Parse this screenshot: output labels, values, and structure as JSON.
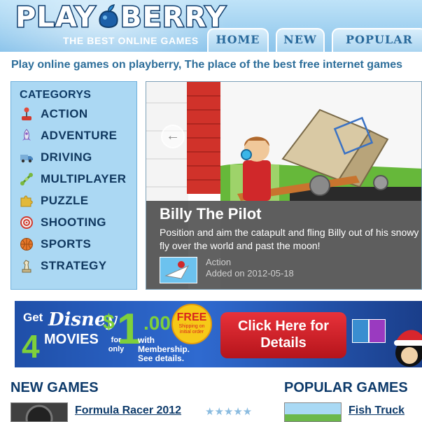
{
  "header": {
    "logo_left": "PLAY",
    "logo_right": "BERRY",
    "tagline": "THE BEST ONLINE GAMES",
    "tabs": [
      {
        "label": "HOME"
      },
      {
        "label": "NEW"
      },
      {
        "label": "POPULAR"
      }
    ]
  },
  "intro": "Play online games on playberry, The place of the best free internet games",
  "categories": {
    "title": "CATEGORYS",
    "items": [
      {
        "label": "ACTION",
        "icon": "joystick-icon"
      },
      {
        "label": "ADVENTURE",
        "icon": "rocket-icon"
      },
      {
        "label": "DRIVING",
        "icon": "truck-icon"
      },
      {
        "label": "MULTIPLAYER",
        "icon": "network-icon"
      },
      {
        "label": "PUZZLE",
        "icon": "puzzle-piece-icon"
      },
      {
        "label": "SHOOTING",
        "icon": "crosshair-icon"
      },
      {
        "label": "SPORTS",
        "icon": "basketball-icon"
      },
      {
        "label": "STRATEGY",
        "icon": "chess-icon"
      }
    ]
  },
  "featured": {
    "title": "Billy The Pilot",
    "description": "Position and aim the catapult and fling Billy out of his snowy you can fly over the world and past the moon!",
    "category": "Action",
    "added": "Added on 2012-05-18"
  },
  "banner": {
    "get": "Get",
    "brand": "Disney",
    "count": "4",
    "movies": "MOVIES",
    "dollar": "$",
    "price_whole": "1",
    "price_cents": ".00",
    "for_only": "for only",
    "with_membership": "with Membership. See details.",
    "free_big": "FREE",
    "free_small": "Shipping on initial order",
    "cta": "Click Here for Details"
  },
  "sections": {
    "new_games": {
      "title": "NEW GAMES",
      "first_item": {
        "name": "Formula Racer 2012",
        "rating": 4
      }
    },
    "popular_games": {
      "title": "POPULAR GAMES",
      "first_item": {
        "name": "Fish Truck"
      }
    }
  },
  "colors": {
    "header_blue": "#9fd0f0",
    "category_panel": "#abd8f3",
    "heading_navy": "#0d3a6a",
    "intro_blue": "#2d6e9a"
  }
}
